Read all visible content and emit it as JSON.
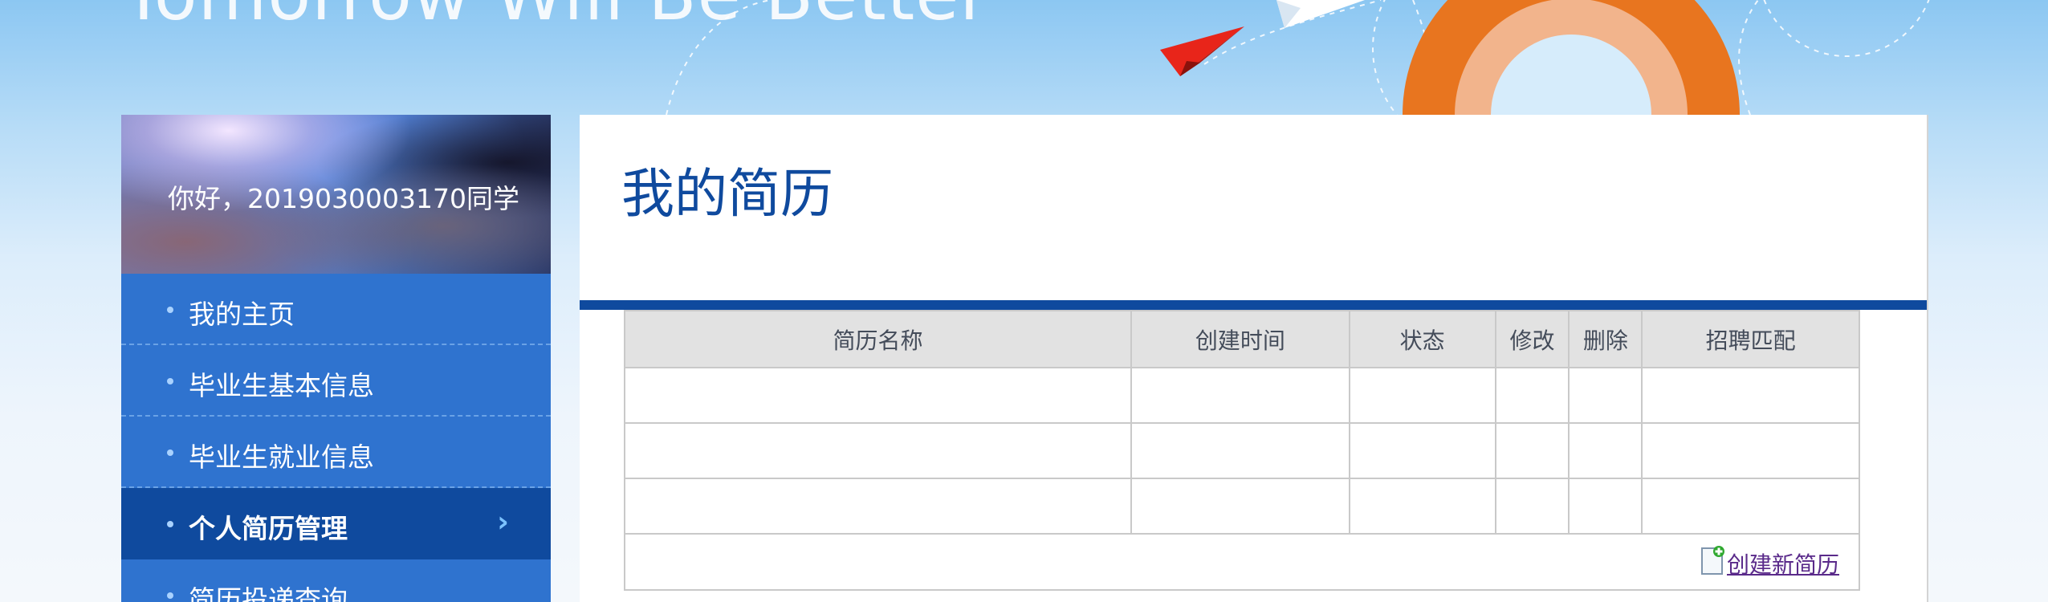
{
  "banner": {
    "slogan": "Tomorrow Will Be Better"
  },
  "sidebar": {
    "greeting": "你好，2019030003170同学",
    "items": [
      {
        "label": "我的主页",
        "active": false
      },
      {
        "label": "毕业生基本信息",
        "active": false
      },
      {
        "label": "毕业生就业信息",
        "active": false
      },
      {
        "label": "个人简历管理",
        "active": true
      },
      {
        "label": "简历投递查询",
        "active": false
      }
    ],
    "active_arrow": "›"
  },
  "main": {
    "title": "我的简历",
    "table": {
      "headers": [
        "简历名称",
        "创建时间",
        "状态",
        "修改",
        "删除",
        "招聘匹配"
      ],
      "rows": [
        [
          "",
          "",
          "",
          "",
          "",
          ""
        ],
        [
          "",
          "",
          "",
          "",
          "",
          ""
        ],
        [
          "",
          "",
          "",
          "",
          "",
          ""
        ]
      ],
      "create_link_label": "创建新简历",
      "create_link_icon": "new-document-icon"
    }
  },
  "colors": {
    "accent_dark": "#0f4a9e",
    "nav_blue": "#2f73cf",
    "link_purple": "#5a2a8a"
  }
}
